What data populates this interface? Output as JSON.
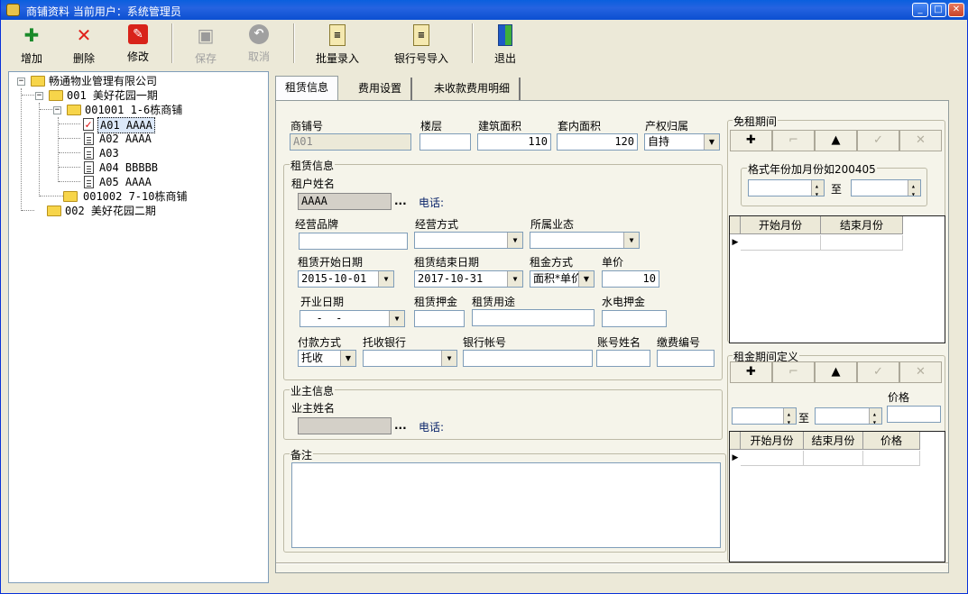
{
  "window": {
    "title": "商铺资料   当前用户：系统管理员",
    "buttons": {
      "min": "_",
      "max": "□",
      "close": "✕"
    }
  },
  "toolbar": {
    "add": "增加",
    "delete": "删除",
    "edit": "修改",
    "save": "保存",
    "cancel": "取消",
    "batch_entry": "批量录入",
    "bank_import": "银行号导入",
    "exit": "退出"
  },
  "tree": {
    "root": "畅通物业管理有限公司",
    "n001": "001 美好花园一期",
    "n001001": "001001 1-6栋商铺",
    "a01": "A01 AAAA",
    "a02": "A02 AAAA",
    "a03": "A03",
    "a04": "A04 BBBBB",
    "a05": "A05 AAAA",
    "n001002": "001002 7-10栋商铺",
    "n002": "002 美好花园二期",
    "minus": "−"
  },
  "tabs": [
    "租赁信息",
    "费用设置",
    "未收款费用明细"
  ],
  "form": {
    "shop_no_label": "商铺号",
    "shop_no": "A01",
    "floor_label": "楼层",
    "floor": "",
    "building_area_label": "建筑面积",
    "building_area": "110",
    "inner_area_label": "套内面积",
    "inner_area": "120",
    "ownership_label": "产权归属",
    "ownership": "自持",
    "lease_group": "租赁信息",
    "tenant_name_label": "租户姓名",
    "tenant_name": "AAAA",
    "ellipsis": "...",
    "phone_label": "电话:",
    "brand_label": "经营品牌",
    "operation_mode_label": "经营方式",
    "business_type_label": "所属业态",
    "lease_start_label": "租赁开始日期",
    "lease_start": "2015-10-01",
    "lease_end_label": "租赁结束日期",
    "lease_end": "2017-10-31",
    "rent_method_label": "租金方式",
    "rent_method": "面积*单价",
    "unit_price_label": "单价",
    "unit_price": "10",
    "open_date_label": "开业日期",
    "open_date": "  -  -",
    "deposit_label": "租赁押金",
    "usage_label": "租赁用途",
    "utility_deposit_label": "水电押金",
    "payment_label": "付款方式",
    "payment": "托收",
    "bank_label": "托收银行",
    "account_label": "银行帐号",
    "account_name_label": "账号姓名",
    "pay_code_label": "缴费编号",
    "owner_group": "业主信息",
    "owner_name_label": "业主姓名",
    "notes_group": "备注"
  },
  "free_rent": {
    "title": "免租期间",
    "format_label": "格式年份加月份如200405",
    "to": "至",
    "col_start": "开始月份",
    "col_end": "结束月份"
  },
  "rent_period": {
    "title": "租金期间定义",
    "to": "至",
    "price_label": "价格",
    "col_start": "开始月份",
    "col_end": "结束月份",
    "col_price": "价格"
  },
  "nav": {
    "add": "✚",
    "first": "⌐",
    "up": "▲",
    "edit": "✓",
    "del": "✕"
  },
  "indicator": "▶",
  "colors": {
    "titlebar": "#0a5fde",
    "face": "#ece9d8",
    "panel": "#f5f4ea",
    "label_blue": "#0a246a"
  }
}
